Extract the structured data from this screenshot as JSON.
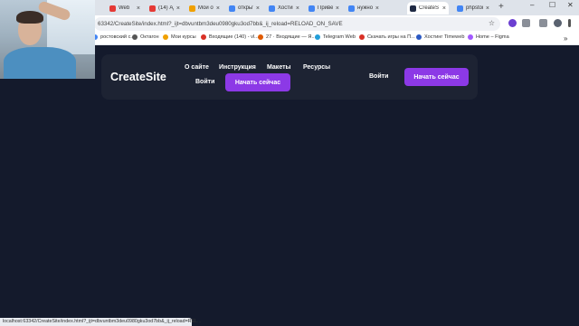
{
  "browser": {
    "tabs": [
      {
        "label": "Web",
        "color": "#e53935"
      },
      {
        "label": "(14) Ад...",
        "color": "#e53935"
      },
      {
        "label": "Мой отз...",
        "color": "#f0a000"
      },
      {
        "label": "открытк...",
        "color": "#4285f4"
      },
      {
        "label": "Хостинг",
        "color": "#4285f4"
      },
      {
        "label": "Привет...",
        "color": "#4285f4"
      },
      {
        "label": "нужно т...",
        "color": "#4285f4"
      },
      {
        "label": "CreateS",
        "color": "#1f2a44",
        "active": true
      },
      {
        "label": "phpstor...",
        "color": "#4285f4"
      }
    ],
    "new_tab": "+",
    "minimize": "–",
    "maximize": "☐",
    "close": "✕",
    "url": "63342/CreateSite/index.html?_ijt=dbvuntbm3deu0980gku3od7bb&_ij_reload=RELOAD_ON_SAVE",
    "bookmarks": [
      {
        "label": "ростовский с...",
        "color": "#4285f4"
      },
      {
        "label": "Октагон",
        "color": "#555555"
      },
      {
        "label": "Мои курсы",
        "color": "#f0a000"
      },
      {
        "label": "Входящие (140) - vl...",
        "color": "#d93025"
      },
      {
        "label": "27 · Входящие — Я...",
        "color": "#e05a00"
      },
      {
        "label": "Telegram Web",
        "color": "#229ed9"
      },
      {
        "label": "Скачать игры на П...",
        "color": "#d93025"
      },
      {
        "label": "Хостинг Timeweb",
        "color": "#2b59c3"
      },
      {
        "label": "Home – Figma",
        "color": "#a259ff"
      }
    ],
    "status_url": "localhost:63342/CreateSite/index.html?_ijt=dbvuntbm3deu0980gku3od7bb&_ij_reload=REL..."
  },
  "site": {
    "logo": "CreateSite",
    "nav": [
      "О сайте",
      "Инструкция",
      "Макеты",
      "Ресурсы"
    ],
    "login": "Войти",
    "cta": "Начать сейчас",
    "accent": "#8c39e6",
    "background": "#141a2c",
    "card": "#1d2333"
  }
}
